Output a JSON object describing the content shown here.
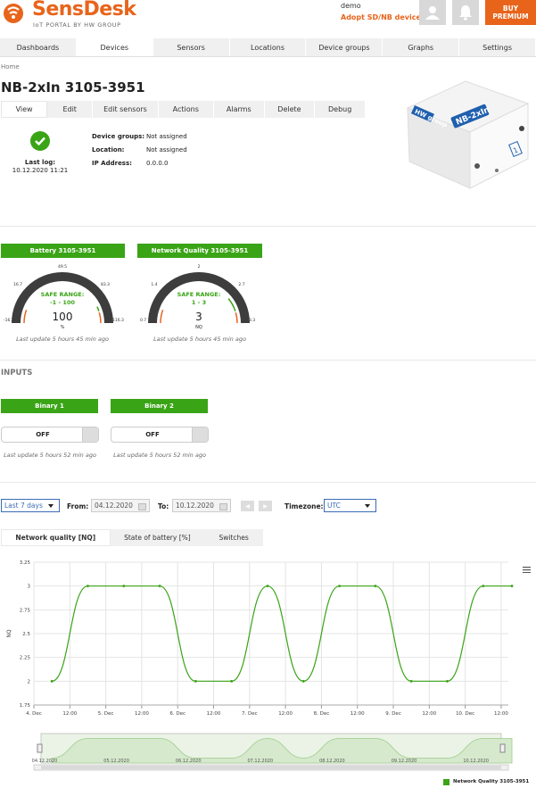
{
  "header": {
    "brand": "SensDesk",
    "tagline": "IoT PORTAL BY HW GROUP",
    "user": "demo",
    "adopt_link": "Adopt SD/NB device",
    "buy_label_1": "BUY",
    "buy_label_2": "PREMIUM"
  },
  "nav": [
    "Dashboards",
    "Devices",
    "Sensors",
    "Locations",
    "Device groups",
    "Graphs",
    "Settings"
  ],
  "breadcrumb": "Home",
  "device": {
    "title": "NB-2xIn 3105-3951",
    "tabs": [
      "View",
      "Edit",
      "Edit sensors",
      "Actions",
      "Alarms",
      "Delete",
      "Debug"
    ],
    "last_log_label": "Last log:",
    "last_log_value": "10.12.2020 11:21",
    "info": [
      {
        "label": "Device groups:",
        "value": "Not assigned"
      },
      {
        "label": "Location:",
        "value": "Not assigned"
      },
      {
        "label": "IP Address:",
        "value": "0.0.0.0"
      }
    ],
    "image_labels": {
      "logo": "HW group",
      "model": "NB-2xIn",
      "digit": "1"
    }
  },
  "gauges": [
    {
      "title": "Battery 3105-3951",
      "safe_label": "SAFE RANGE:",
      "safe_range": "-1 - 100",
      "value": "100",
      "unit": "%",
      "ticks": [
        "-16.3",
        "16.7",
        "49.5",
        "83.3",
        "116.3"
      ],
      "update": "Last update 5 hours 45 min ago",
      "level": 0.96
    },
    {
      "title": "Network Quality 3105-3951",
      "safe_label": "SAFE RANGE:",
      "safe_range": "1 - 3",
      "value": "3",
      "unit": "NQ",
      "ticks": [
        "0.7",
        "1.4",
        "2",
        "2.7",
        "3.3"
      ],
      "update": "Last update 5 hours 45 min ago",
      "level": 0.88
    }
  ],
  "inputs_title": "INPUTS",
  "inputs": [
    {
      "title": "Binary 1",
      "state": "OFF",
      "update": "Last update 5 hours 52 min ago"
    },
    {
      "title": "Binary 2",
      "state": "OFF",
      "update": "Last update 5 hours 52 min ago"
    }
  ],
  "filters": {
    "range": "Last 7 days",
    "from_label": "From:",
    "from_value": "04.12.2020",
    "to_label": "To:",
    "to_value": "10.12.2020",
    "tz_label": "Timezone:",
    "tz_value": "UTC"
  },
  "chart_tabs": [
    "Network quality [NQ]",
    "State of battery [%]",
    "Switches"
  ],
  "chart_data": {
    "type": "line",
    "ylabel": "NQ",
    "ylim": [
      1.75,
      3.25
    ],
    "yticks": [
      "3.25",
      "3",
      "2.75",
      "2.5",
      "2.25",
      "2",
      "1.75"
    ],
    "xticks": [
      "4. Dec",
      "12:00",
      "5. Dec",
      "12:00",
      "6. Dec",
      "12:00",
      "7. Dec",
      "12:00",
      "8. Dec",
      "12:00",
      "9. Dec",
      "12:00",
      "10. Dec",
      "12:00"
    ],
    "xlim_days": [
      0,
      6.6
    ],
    "navigator_ticks": [
      "04.12.2020",
      "05.12.2020",
      "06.12.2020",
      "07.12.2020",
      "08.12.2020",
      "09.12.2020",
      "10.12.2020"
    ],
    "legend_position": "bottom-right",
    "grid": true,
    "series": [
      {
        "name": "Network Quality 3105-3951",
        "color": "#3aa417",
        "points": [
          [
            0.25,
            2
          ],
          [
            0.75,
            3
          ],
          [
            1.25,
            3
          ],
          [
            1.75,
            3
          ],
          [
            2.25,
            2
          ],
          [
            2.75,
            2
          ],
          [
            3.25,
            3
          ],
          [
            3.75,
            2
          ],
          [
            4.25,
            3
          ],
          [
            4.75,
            3
          ],
          [
            5.25,
            2
          ],
          [
            5.75,
            2
          ],
          [
            6.25,
            3
          ],
          [
            6.65,
            3
          ]
        ]
      }
    ]
  }
}
